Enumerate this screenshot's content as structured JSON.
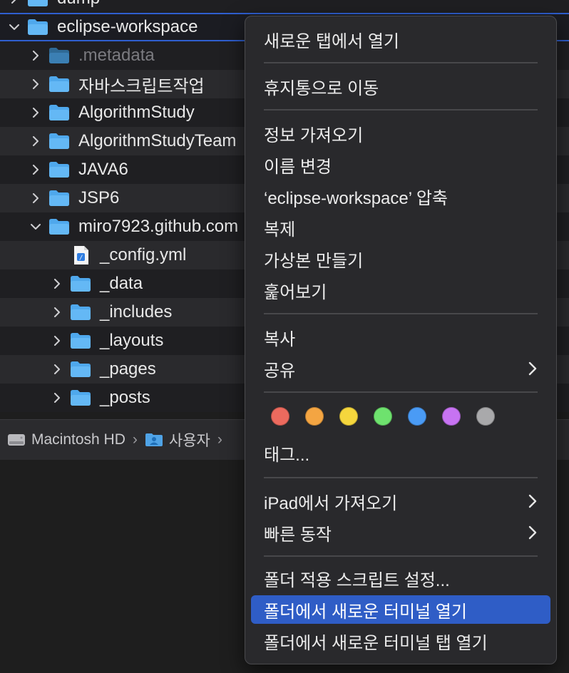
{
  "finder": {
    "rows": [
      {
        "name": "dump",
        "indent": 0,
        "expanded": false,
        "type": "folder"
      },
      {
        "name": "eclipse-workspace",
        "indent": 0,
        "expanded": true,
        "type": "folder"
      },
      {
        "name": ".metadata",
        "indent": 1,
        "expanded": false,
        "type": "folder",
        "dim": true
      },
      {
        "name": "자바스크립트작업",
        "indent": 1,
        "expanded": false,
        "type": "folder"
      },
      {
        "name": "AlgorithmStudy",
        "indent": 1,
        "expanded": false,
        "type": "folder"
      },
      {
        "name": "AlgorithmStudyTeam",
        "indent": 1,
        "expanded": false,
        "type": "folder"
      },
      {
        "name": "JAVA6",
        "indent": 1,
        "expanded": false,
        "type": "folder"
      },
      {
        "name": "JSP6",
        "indent": 1,
        "expanded": false,
        "type": "folder"
      },
      {
        "name": "miro7923.github.com",
        "indent": 1,
        "expanded": true,
        "type": "folder"
      },
      {
        "name": "_config.yml",
        "indent": 2,
        "type": "file"
      },
      {
        "name": "_data",
        "indent": 2,
        "expanded": false,
        "type": "folder"
      },
      {
        "name": "_includes",
        "indent": 2,
        "expanded": false,
        "type": "folder"
      },
      {
        "name": "_layouts",
        "indent": 2,
        "expanded": false,
        "type": "folder"
      },
      {
        "name": "_pages",
        "indent": 2,
        "expanded": false,
        "type": "folder"
      },
      {
        "name": "_posts",
        "indent": 2,
        "expanded": false,
        "type": "folder"
      }
    ]
  },
  "pathbar": {
    "drive": "Macintosh HD",
    "users": "사용자"
  },
  "menu": {
    "open_new_tab": "새로운 탭에서 열기",
    "move_to_trash": "휴지통으로 이동",
    "get_info": "정보 가져오기",
    "rename": "이름 변경",
    "compress": "‘eclipse-workspace’ 압축",
    "duplicate": "복제",
    "make_alias": "가상본 만들기",
    "quick_look": "훑어보기",
    "copy": "복사",
    "share": "공유",
    "tags": "태그...",
    "import_ipad": "iPad에서 가져오기",
    "quick_actions": "빠른 동작",
    "folder_actions": "폴더 적용 스크립트 설정...",
    "new_terminal": "폴더에서 새로운 터미널 열기",
    "new_terminal_tab": "폴더에서 새로운 터미널 탭 열기",
    "tag_colors": [
      {
        "name": "red",
        "color": "#ec6a5e"
      },
      {
        "name": "orange",
        "color": "#f4a542"
      },
      {
        "name": "yellow",
        "color": "#f5d63d"
      },
      {
        "name": "green",
        "color": "#6ee26e"
      },
      {
        "name": "blue",
        "color": "#4a9bf5"
      },
      {
        "name": "purple",
        "color": "#c773f2"
      },
      {
        "name": "gray",
        "color": "#a9a9ab"
      }
    ],
    "highlight_color": "#2f5dc6"
  }
}
